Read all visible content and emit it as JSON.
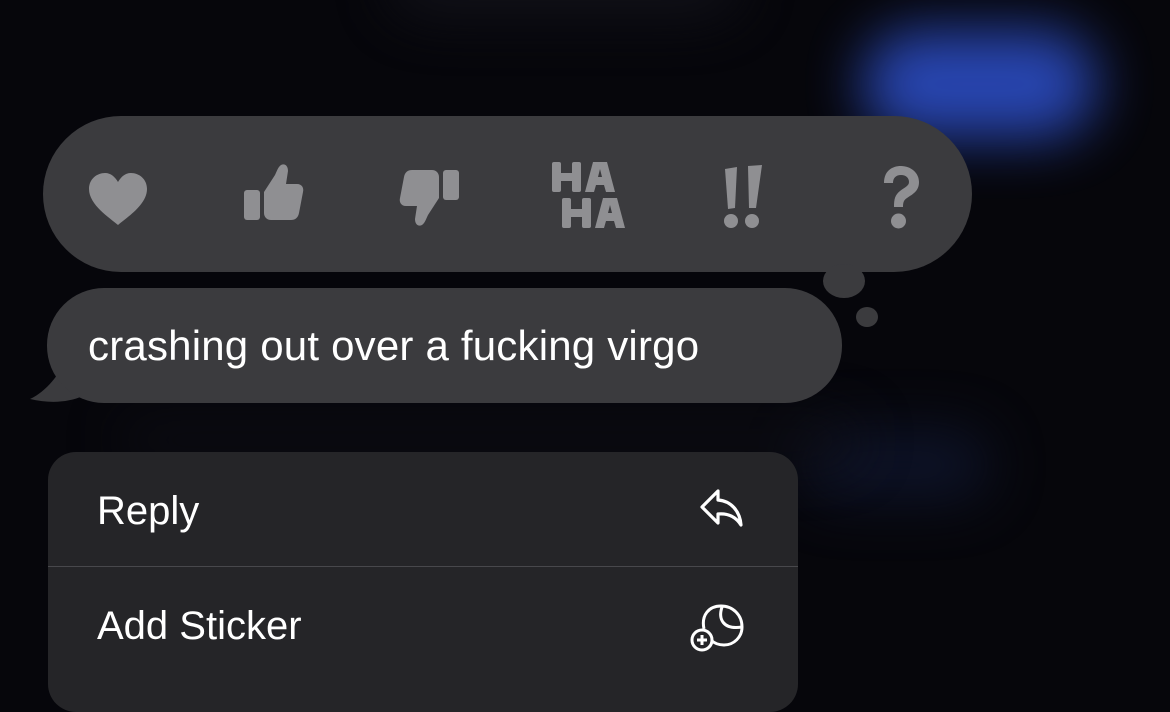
{
  "tapback": {
    "reactions": [
      {
        "icon": "heart-icon",
        "label": "Heart"
      },
      {
        "icon": "thumbs-up-icon",
        "label": "Like"
      },
      {
        "icon": "thumbs-down-icon",
        "label": "Dislike"
      },
      {
        "icon": "haha-icon",
        "label": "Laugh"
      },
      {
        "icon": "exclamation-icon",
        "label": "Emphasize"
      },
      {
        "icon": "question-icon",
        "label": "Question"
      }
    ]
  },
  "message": {
    "text": "crashing out over a fucking virgo"
  },
  "context_menu": {
    "items": [
      {
        "label": "Reply",
        "icon": "reply-icon"
      },
      {
        "label": "Add Sticker",
        "icon": "add-sticker-icon"
      }
    ]
  },
  "colors": {
    "background": "#06060b",
    "bubble": "#3b3b3e",
    "menu": "#252528",
    "icon": "#8f8f92",
    "text": "#ffffff",
    "accent_glow": "#2a49b9"
  }
}
